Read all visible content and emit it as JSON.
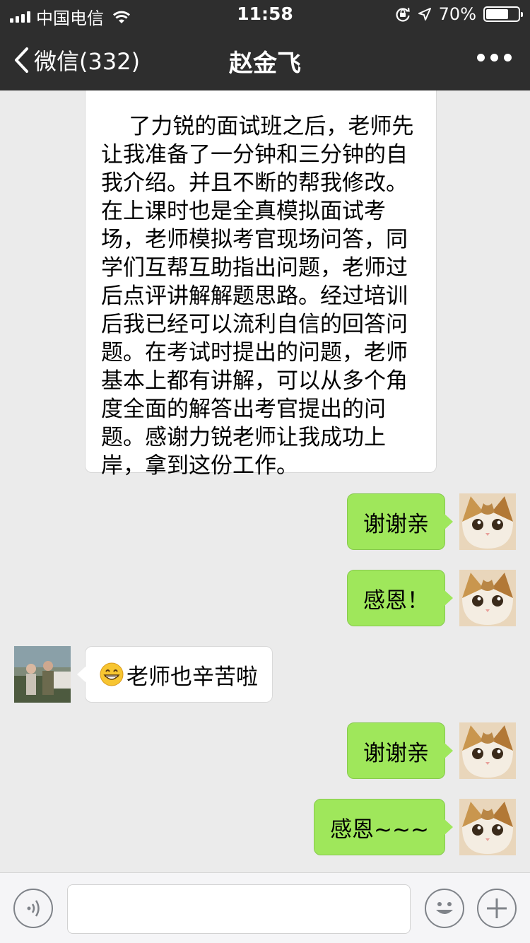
{
  "status_bar": {
    "carrier": "中国电信",
    "time": "11:58",
    "battery_percent_label": "70%",
    "battery_level": 0.7
  },
  "nav": {
    "back_label": "微信(332)",
    "title": "赵金飞"
  },
  "messages": [
    {
      "side": "left",
      "text": "了力锐的面试班之后，老师先让我准备了一分钟和三分钟的自我介绍。并且不断的帮我修改。在上课时也是全真模拟面试考场，老师模拟考官现场问答，同学们互帮互助指出问题，老师过后点评讲解解题思路。经过培训后我已经可以流利自信的回答问题。在考试时提出的问题，老师基本上都有讲解，可以从多个角度全面的解答出考官提出的问题。感谢力锐老师让我成功上岸，拿到这份工作。"
    },
    {
      "side": "right",
      "text": "谢谢亲"
    },
    {
      "side": "right",
      "text": "感恩！"
    },
    {
      "side": "left",
      "emoji": "grinning-face",
      "text": "老师也辛苦啦"
    },
    {
      "side": "right",
      "text": "谢谢亲"
    },
    {
      "side": "right",
      "text": "感恩~~~"
    }
  ],
  "colors": {
    "nav_background": "#2e2e2e",
    "chat_background": "#ebebeb",
    "self_bubble": "#9fe75b",
    "other_bubble": "#ffffff"
  }
}
